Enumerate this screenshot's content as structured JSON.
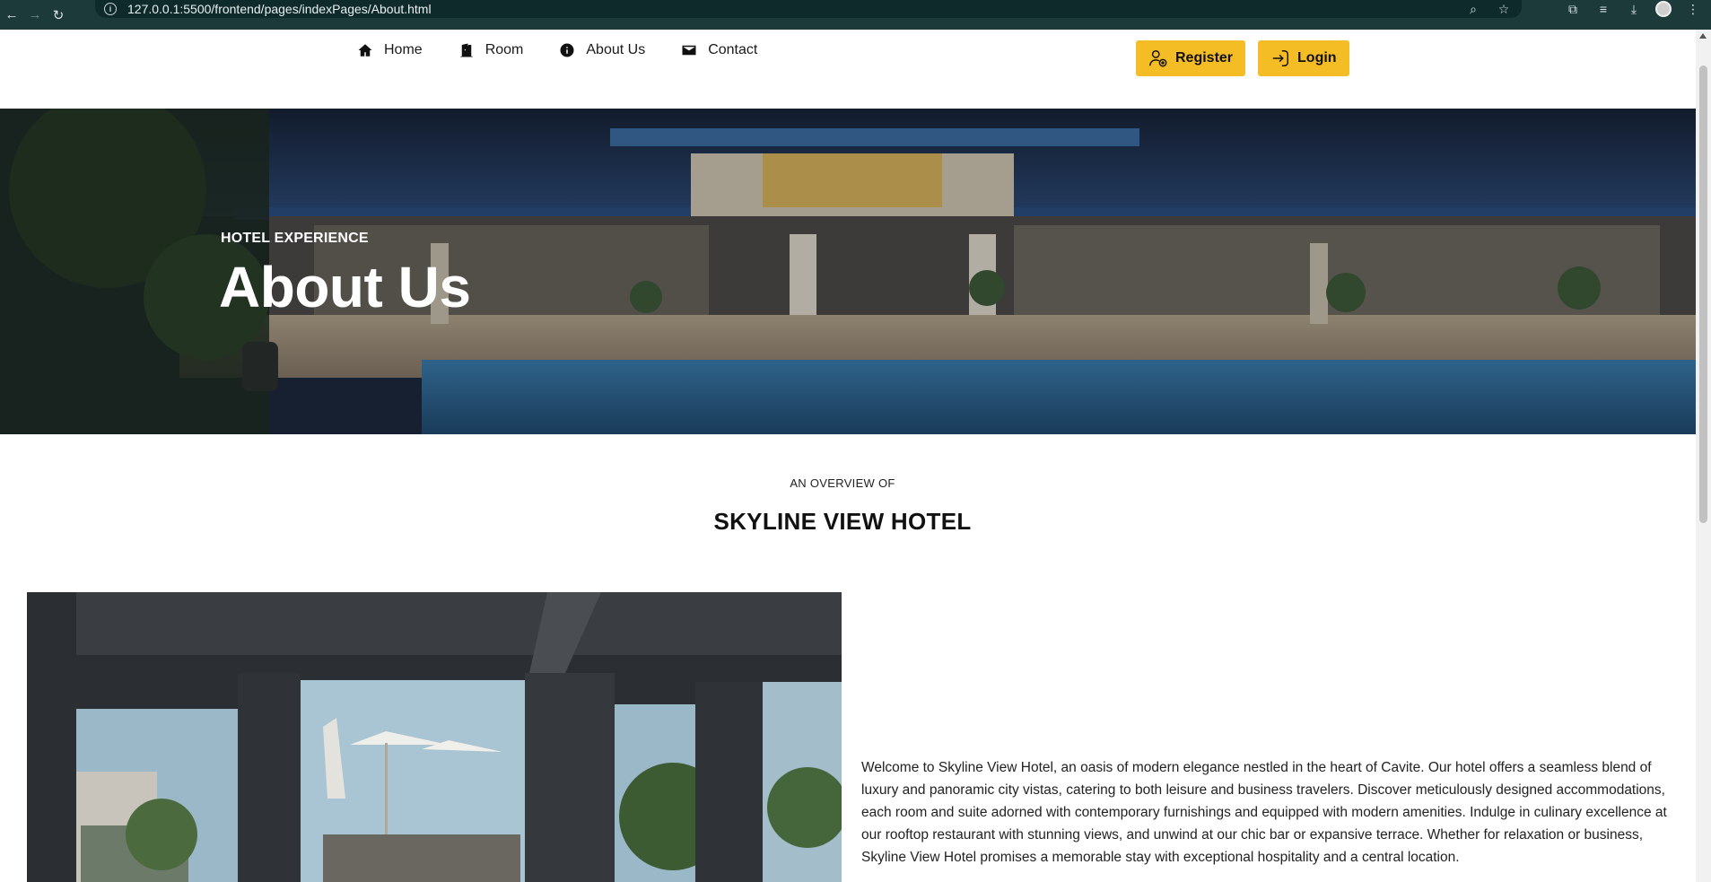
{
  "browser": {
    "url": "127.0.0.1:5500/frontend/pages/indexPages/About.html"
  },
  "nav": {
    "items": [
      {
        "label": "Home",
        "icon": "home-icon"
      },
      {
        "label": "Room",
        "icon": "door-icon"
      },
      {
        "label": "About Us",
        "icon": "info-icon"
      },
      {
        "label": "Contact",
        "icon": "envelope-icon"
      }
    ],
    "register_label": "Register",
    "login_label": "Login",
    "accent_color": "#f5bd25"
  },
  "hero": {
    "kicker": "HOTEL EXPERIENCE",
    "title": "About Us"
  },
  "overview": {
    "kicker": "AN OVERVIEW OF",
    "title": "SKYLINE VIEW HOTEL"
  },
  "about": {
    "paragraph": "Welcome to Skyline View Hotel, an oasis of modern elegance nestled in the heart of Cavite. Our hotel offers a seamless blend of luxury and panoramic city vistas, catering to both leisure and business travelers. Discover meticulously designed accommodations, each room and suite adorned with contemporary furnishings and equipped with modern amenities. Indulge in culinary excellence at our rooftop restaurant with stunning views, and unwind at our chic bar or expansive terrace. Whether for relaxation or business, Skyline View Hotel promises a memorable stay with exceptional hospitality and a central location."
  }
}
